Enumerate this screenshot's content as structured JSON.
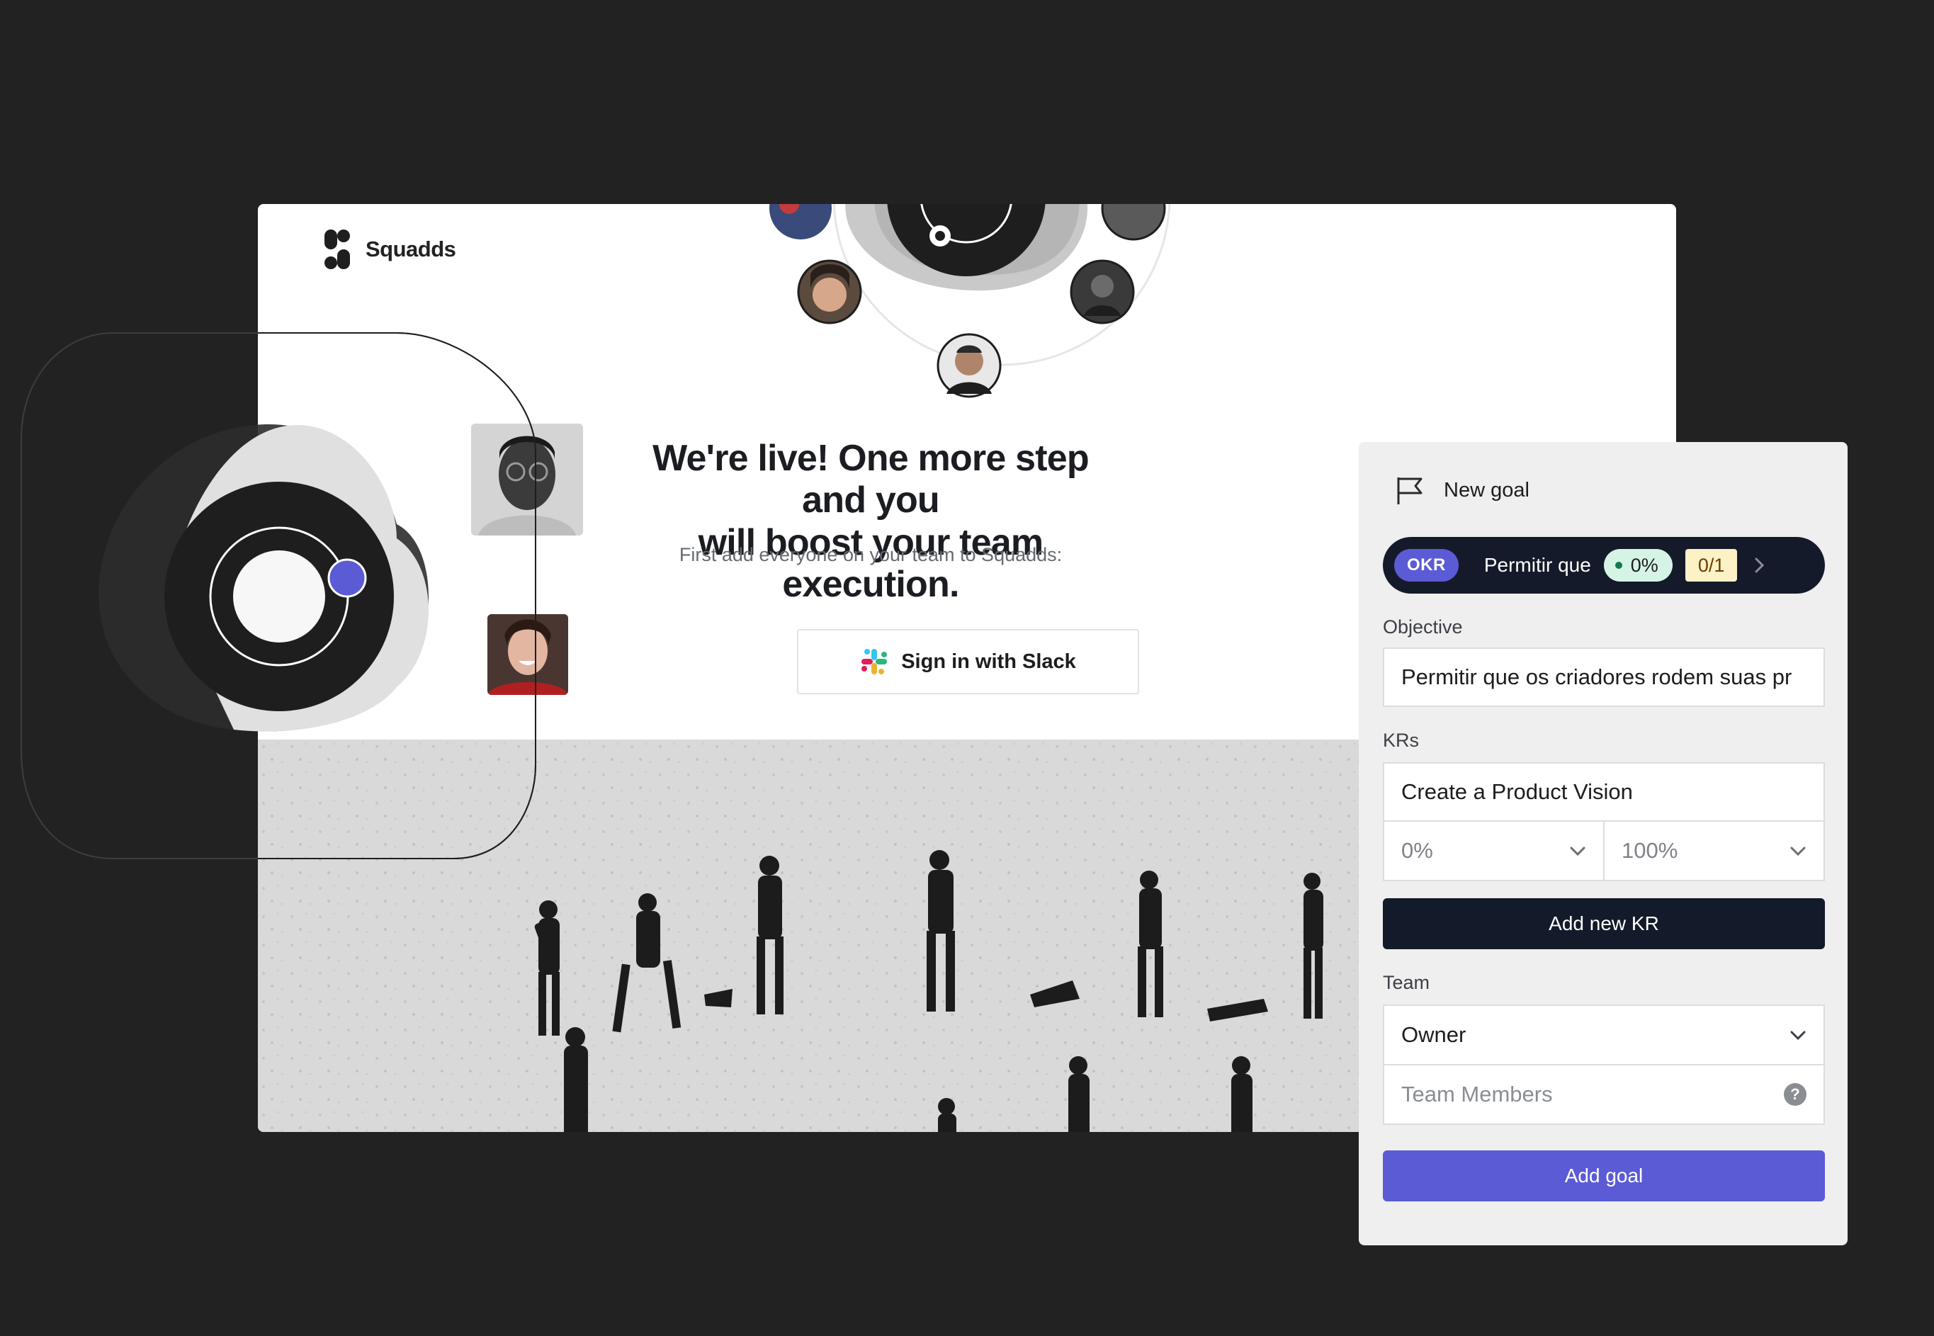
{
  "landing": {
    "brand": "Squadds",
    "headline_line1": "We're live! One more step and you",
    "headline_line2": "will boost your team execution.",
    "subline": "First add everyone on your team to Squadds:",
    "slack_button": "Sign in with Slack"
  },
  "panel": {
    "title": "New goal",
    "okr": {
      "badge": "OKR",
      "text": "Permitir que",
      "progress": "0%",
      "ratio": "0/1"
    },
    "objective_label": "Objective",
    "objective_value": "Permitir que os criadores rodem suas pr",
    "krs_label": "KRs",
    "kr_value": "Create a Product Vision",
    "kr_from": "0%",
    "kr_to": "100%",
    "add_kr_button": "Add new KR",
    "team_label": "Team",
    "owner_value": "Owner",
    "members_placeholder": "Team Members",
    "add_goal_button": "Add goal"
  },
  "colors": {
    "background": "#222222",
    "accent": "#5b5bd6",
    "dark_button": "#131a29",
    "progress_bg": "#d6f4e6",
    "ratio_bg": "#fdf1c6"
  }
}
